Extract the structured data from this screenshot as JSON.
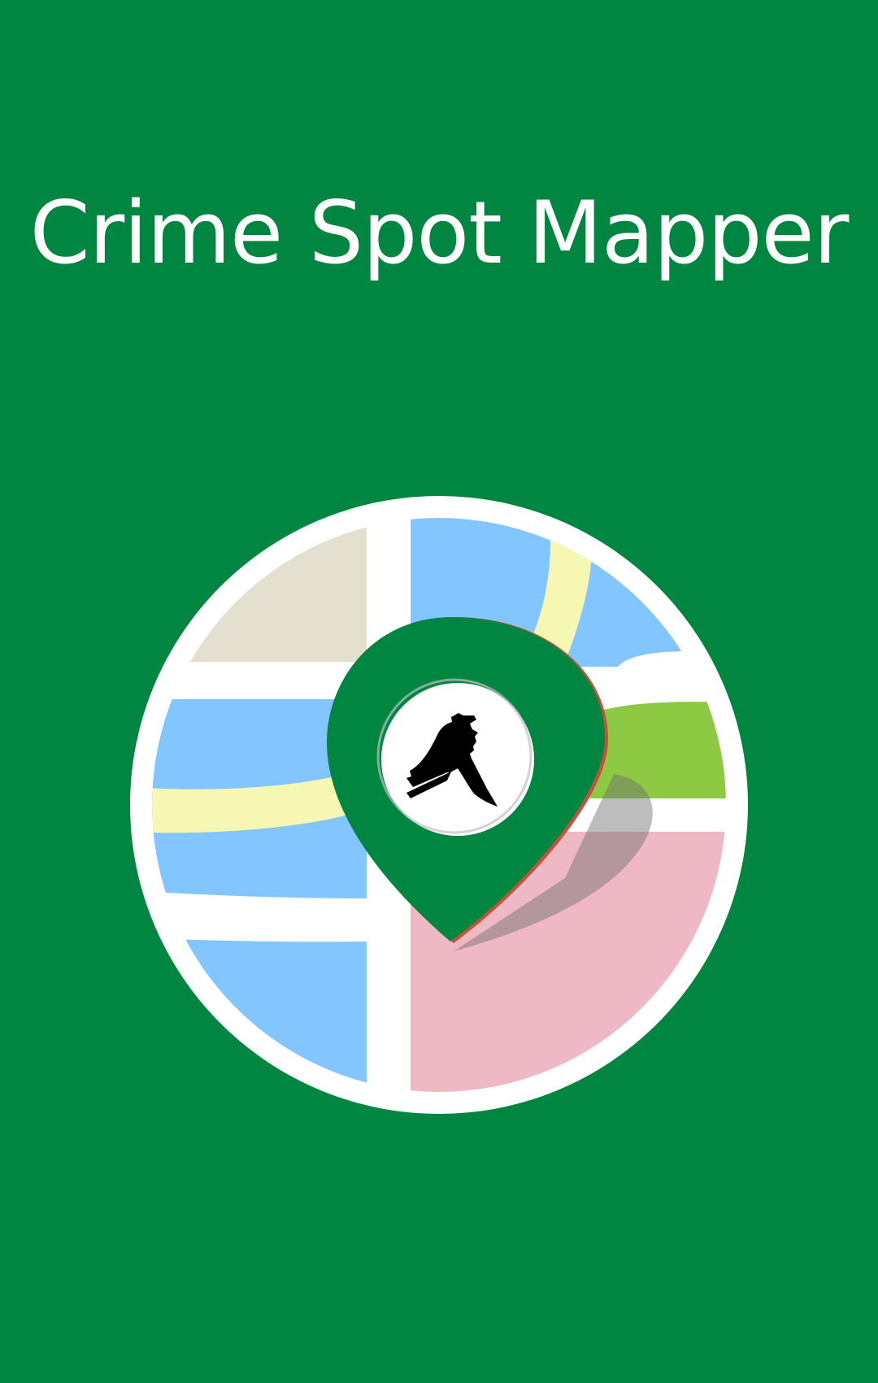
{
  "app": {
    "title": "Crime Spot Mapper"
  },
  "logo": {
    "icon": "crime-location-map-icon",
    "colors": {
      "background": "#008640",
      "pin": "#008640",
      "pin_shadow": "#c6503c",
      "map_border": "#ffffff",
      "map_blue": "#82c5ff",
      "map_yellow": "#f6f7b2",
      "map_beige": "#e3e0cf",
      "map_green": "#8dc943",
      "map_pink": "#efb8c5",
      "knife_icon": "#000000"
    }
  }
}
